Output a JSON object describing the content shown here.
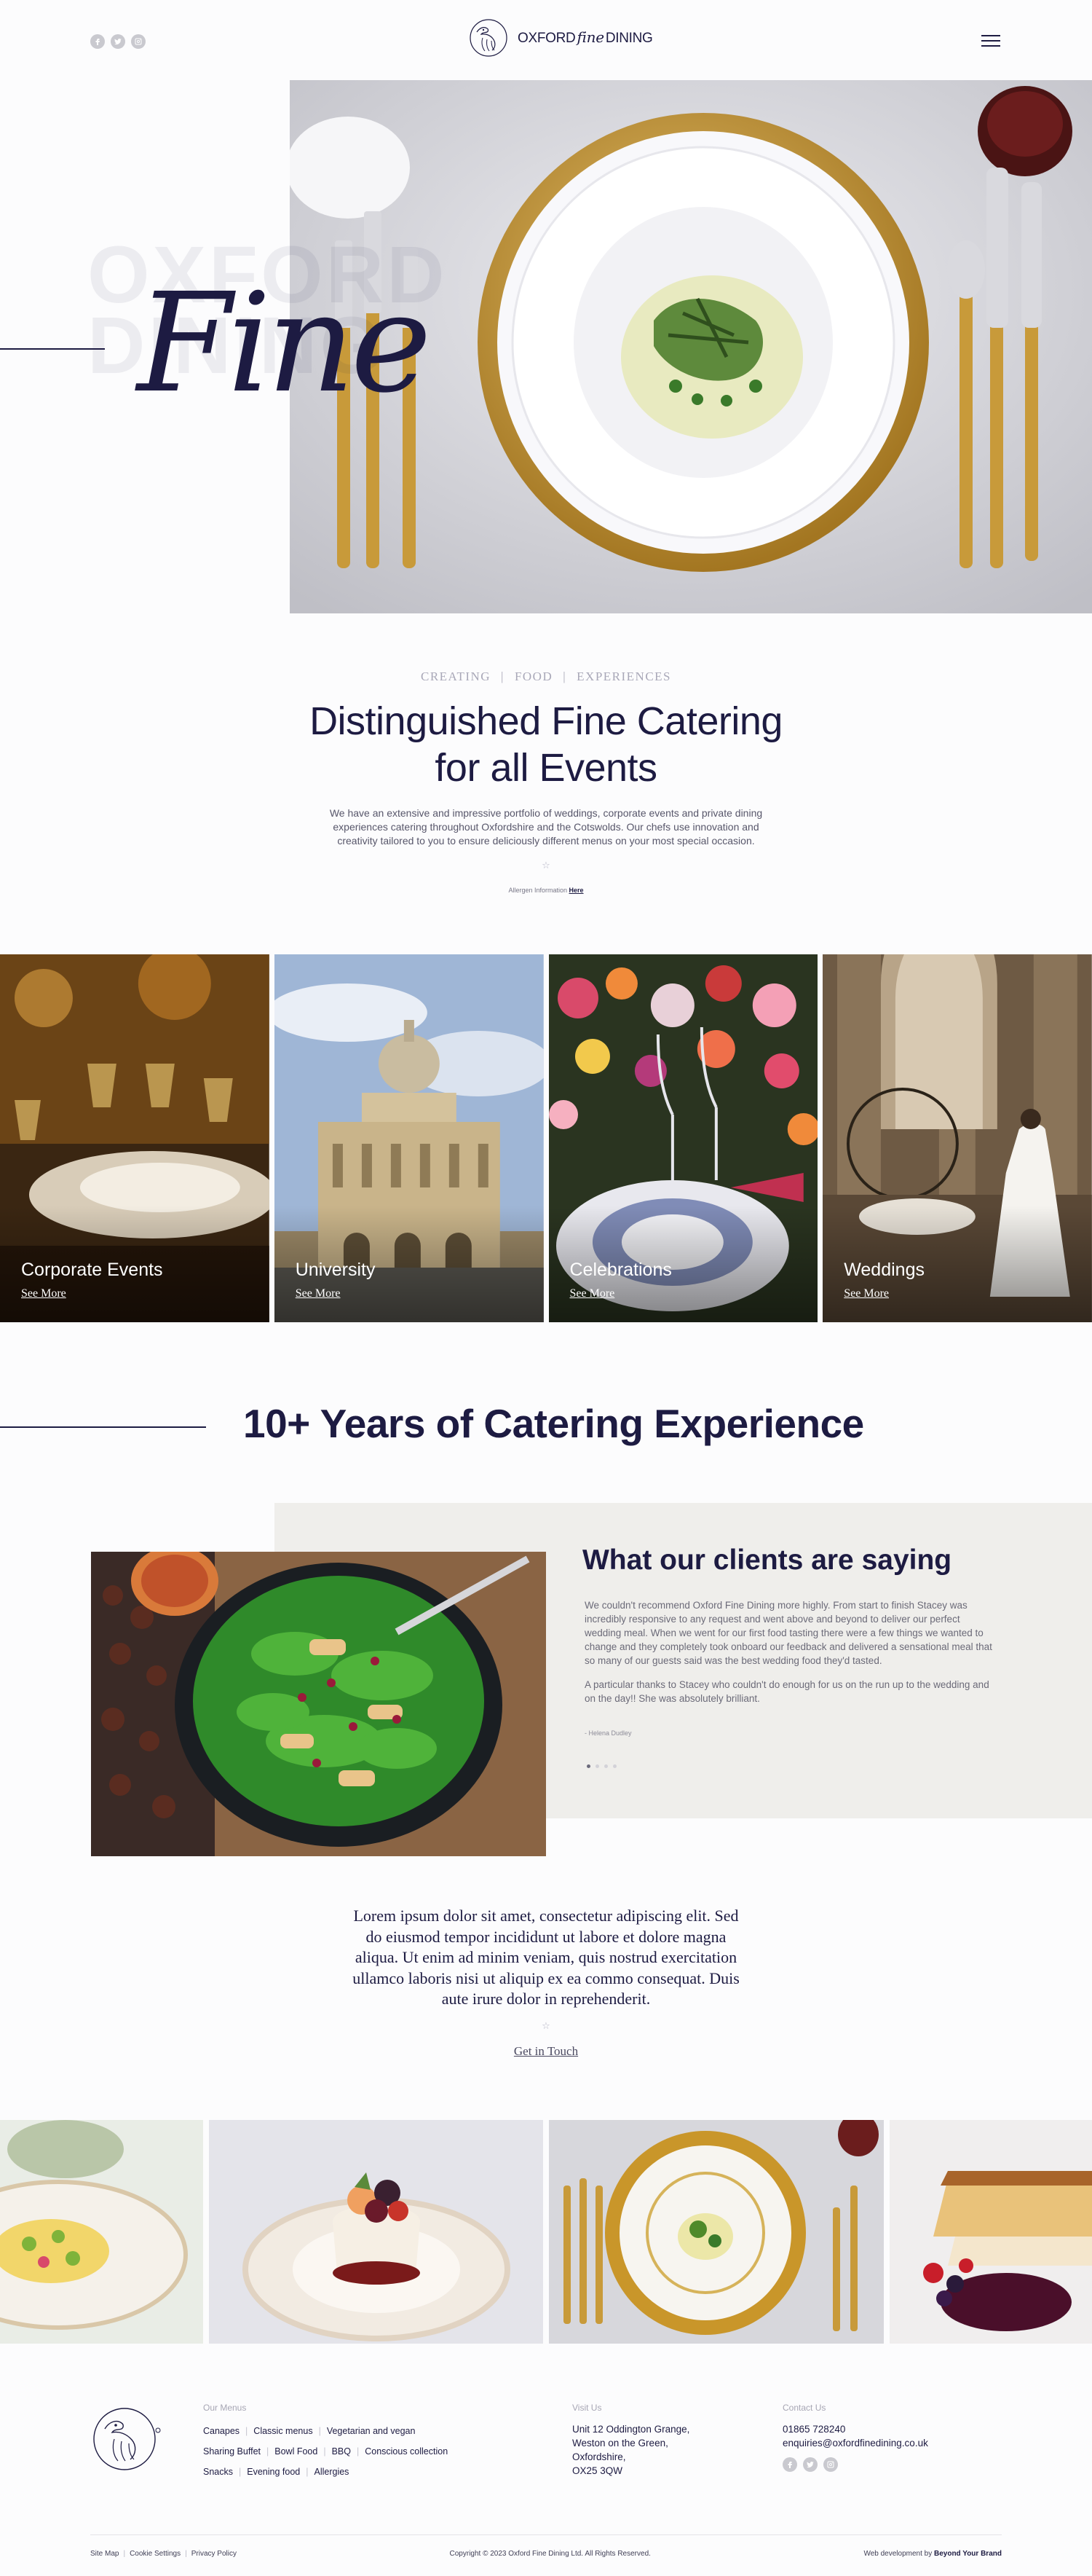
{
  "header": {
    "logo": {
      "word1": "OXFORD",
      "word2": "fine",
      "word3": "DINING"
    },
    "social_icons": [
      "facebook-icon",
      "twitter-icon",
      "instagram-icon"
    ],
    "menu_icon": "hamburger-menu-icon"
  },
  "hero": {
    "watermark_line1": "OXFORD",
    "watermark_line2": "DINING",
    "script_word": "Fine"
  },
  "intro": {
    "tags": [
      "CREATING",
      "FOOD",
      "EXPERIENCES"
    ],
    "tag_separator": "|",
    "title_line1": "Distinguished Fine Catering",
    "title_line2": "for all Events",
    "body": "We have an extensive and impressive portfolio of weddings, corporate events and private dining experiences catering throughout Oxfordshire and the Cotswolds. Our chefs use innovation and creativity tailored to you to ensure deliciously different menus on your most special occasion.",
    "star": "☆",
    "allergen_prefix": "Allergen Information",
    "allergen_link": "Here"
  },
  "tiles": [
    {
      "title": "Corporate Events",
      "more": "See More"
    },
    {
      "title": "University",
      "more": "See More"
    },
    {
      "title": "Celebrations",
      "more": "See More"
    },
    {
      "title": "Weddings",
      "more": "See More"
    }
  ],
  "experience": {
    "title": "10+ Years of Catering Experience"
  },
  "testimonial": {
    "title": "What our clients are saying",
    "para1": "We couldn't recommend Oxford Fine Dining more highly. From start to finish Stacey was incredibly responsive to any request and went above and beyond to deliver our perfect wedding meal. When we went for our first food tasting there were a few things we wanted to change and they completely took onboard our feedback and delivered a sensational meal that so many of our guests said was the best wedding food they'd tasted.",
    "para2": "A particular thanks to Stacey who couldn't do enough for us on the run up to the wedding and on the day!! She was absolutely brilliant.",
    "author": "- Helena Dudley",
    "slides": 4,
    "active_slide": 1
  },
  "cta": {
    "lorem": "Lorem ipsum dolor sit amet, consectetur adipiscing elit. Sed do eiusmod tempor incididunt ut labore et dolore magna aliqua. Ut enim ad minim veniam, quis nostrud exercitation ullamco laboris nisi ut aliquip ex ea commo consequat. Duis aute irure dolor in reprehenderit.",
    "star": "☆",
    "button": "Get in Touch"
  },
  "footer": {
    "menus_heading": "Our Menus",
    "menu_rows": [
      [
        "Canapes",
        "Classic menus",
        "Vegetarian and vegan"
      ],
      [
        "Sharing Buffet",
        "Bowl Food",
        "BBQ",
        "Conscious collection"
      ],
      [
        "Snacks",
        "Evening food",
        "Allergies"
      ]
    ],
    "visit_heading": "Visit Us",
    "address": [
      "Unit 12 Oddington Grange,",
      "Weston on the Green,",
      "Oxfordshire,",
      "OX25 3QW"
    ],
    "contact_heading": "Contact Us",
    "phone": "01865 728240",
    "email": "enquiries@oxfordfinedining.co.uk",
    "legal_links": [
      "Site Map",
      "Cookie Settings",
      "Privacy Policy"
    ],
    "copyright": "Copyright © 2023 Oxford Fine Dining Ltd. All Rights Reserved.",
    "credit_prefix": "Web development by",
    "credit_name": "Beyond Your Brand"
  }
}
